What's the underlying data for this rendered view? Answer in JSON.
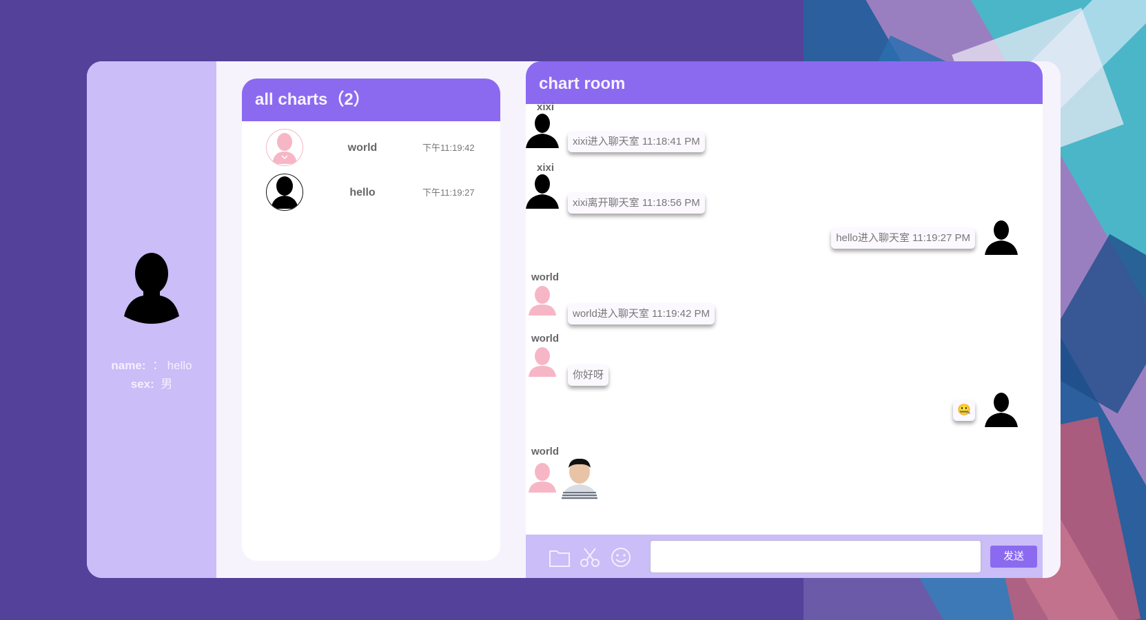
{
  "profile": {
    "name_label": "name:",
    "name_value": "： hello",
    "sex_label": "sex:",
    "sex_value": "男"
  },
  "chats": {
    "title": "all charts（2）",
    "items": [
      {
        "name": "world",
        "time": "下午11:19:42",
        "avatar": "female-avatar-icon"
      },
      {
        "name": "hello",
        "time": "下午11:19:27",
        "avatar": "male-avatar-icon"
      }
    ]
  },
  "room": {
    "title": "chart room",
    "messages": [
      {
        "user": "xixi",
        "text": "xixi进入聊天室 11:18:41 PM",
        "side": "left"
      },
      {
        "user": "xixi",
        "text": "xixi离开聊天室 11:18:56 PM",
        "side": "left"
      },
      {
        "user": "",
        "text": "hello进入聊天室 11:19:27 PM",
        "side": "right"
      },
      {
        "user": "world",
        "text": "world进入聊天室 11:19:42 PM",
        "side": "left"
      },
      {
        "user": "world",
        "text": "你好呀",
        "side": "left"
      },
      {
        "user": "",
        "text": "🤐",
        "side": "right"
      },
      {
        "user": "world",
        "text": "",
        "side": "left",
        "attachment": "photo"
      }
    ]
  },
  "input_bar": {
    "tools": [
      "folder-icon",
      "scissors-icon",
      "emoji-icon"
    ],
    "send_label": "发送",
    "placeholder": ""
  },
  "colors": {
    "page_bg": "#54419a",
    "accent": "#8b6af0",
    "profile_bg": "#cbbdf7"
  }
}
